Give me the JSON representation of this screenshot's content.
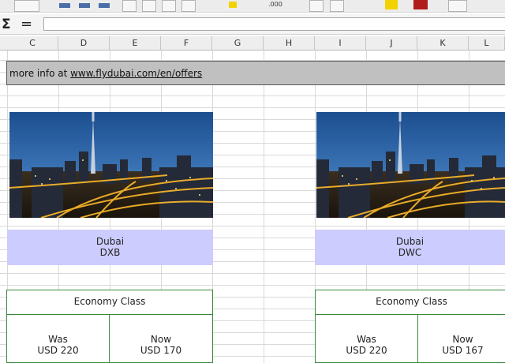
{
  "toolbar": {
    "number_label": ".000",
    "icons": [
      "font-size-box",
      "bold-icon",
      "italic-icon",
      "underline-icon",
      "align-left-icon",
      "align-center-icon",
      "align-right-icon",
      "merge-icon",
      "highlight-icon",
      "number-format-icon",
      "border-icon",
      "table-icon",
      "background-color-icon",
      "font-color-icon",
      "sidebar-icon"
    ]
  },
  "formula_bar": {
    "sigma": "Σ",
    "equals": "=",
    "value": ""
  },
  "columns": [
    "C",
    "D",
    "E",
    "F",
    "G",
    "H",
    "I",
    "J",
    "K",
    "L"
  ],
  "banner": {
    "prefix": "more info at ",
    "link": "www.flydubai.com/en/offers"
  },
  "blocks": [
    {
      "city": "Dubai",
      "code": "DXB",
      "class_label": "Economy Class",
      "was_label": "Was",
      "was_price": "USD 220",
      "now_label": "Now",
      "now_price": "USD 170"
    },
    {
      "city": "Dubai",
      "code": "DWC",
      "class_label": "Economy Class",
      "was_label": "Was",
      "was_price": "USD 220",
      "now_label": "Now",
      "now_price": "USD 167"
    }
  ]
}
